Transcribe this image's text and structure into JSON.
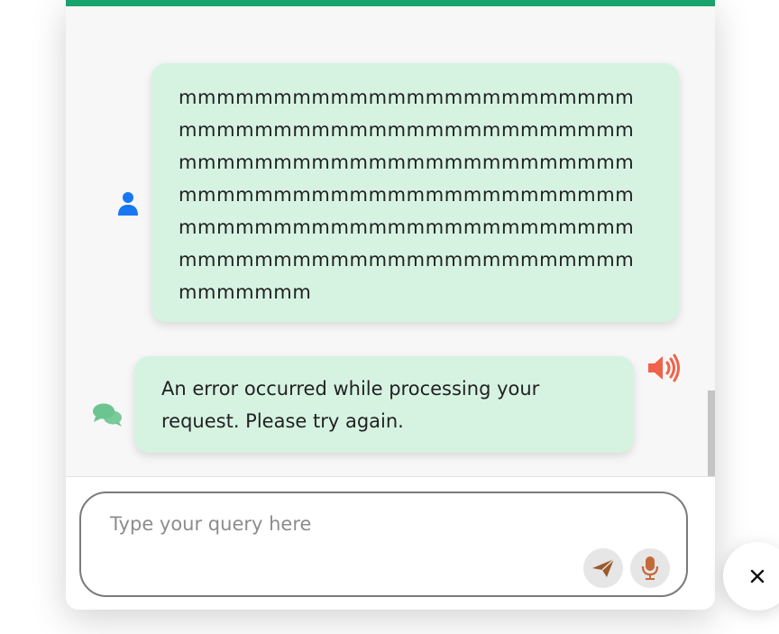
{
  "colors": {
    "accent": "#17a36b",
    "bubble_bg": "#d6f3e2",
    "user_icon": "#1877f2",
    "bot_icon": "#6cc48f",
    "speaker_icon": "#f0624a",
    "send_icon": "#9a5a2a",
    "mic_icon": "#c46a3a"
  },
  "messages": [
    {
      "role": "user",
      "avatar_icon": "user-icon",
      "text": "mmmmmmmmmmmmmmmmmmmmmmmmmmmmmmmmmmmmmmmmmmmmmmmmmmmmmmmmmmmmmmmmmmmmmmmmmmmmmmmmmmmmmmmmmmmmmmmmmmmmmmmmmmmmmmmmmmmmmmmmmmmmmmmmmmmmmmmmmmmmmmmmmmmmmmm"
    },
    {
      "role": "bot",
      "avatar_icon": "chat-bubbles-icon",
      "action_icon": "speaker-icon",
      "text": "An error occurred while processing your request. Please try again."
    }
  ],
  "composer": {
    "placeholder": "Type your query here",
    "value": "",
    "send_icon": "send-icon",
    "mic_icon": "microphone-icon"
  },
  "launcher": {
    "close_label": "✕"
  }
}
